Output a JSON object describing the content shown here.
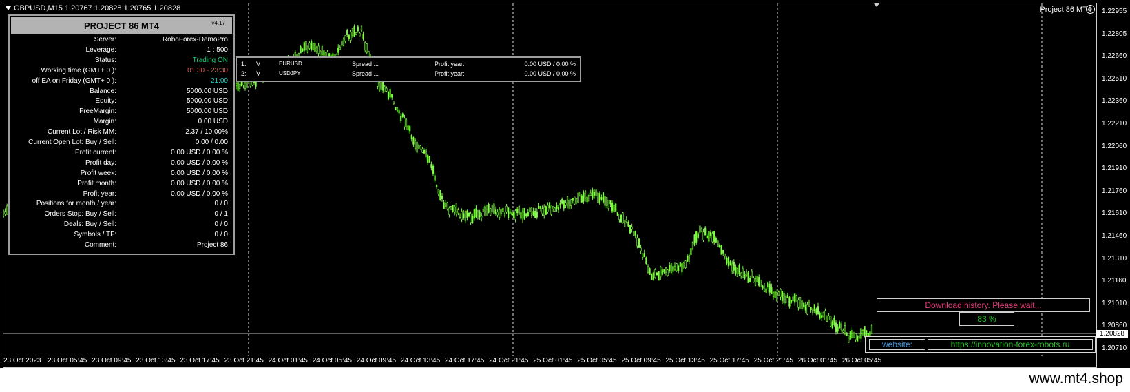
{
  "chart": {
    "symbol_header": "GBPUSD,M15  1.20767 1.20828 1.20765 1.20828",
    "ea_label": "Project 86 MT4",
    "current_price": "1.20828",
    "bull_color": "#7cff3c",
    "bear_color": "#7cff3c",
    "price_ticks": [
      "1.22955",
      "1.22805",
      "1.22660",
      "1.22510",
      "1.22360",
      "1.22210",
      "1.22060",
      "1.21910",
      "1.21760",
      "1.21610",
      "1.21460",
      "1.21310",
      "1.21160",
      "1.21010",
      "1.20860",
      "1.20710"
    ],
    "time_ticks": [
      "23 Oct 2023",
      "23 Oct 05:45",
      "23 Oct 09:45",
      "23 Oct 13:45",
      "23 Oct 17:45",
      "23 Oct 21:45",
      "24 Oct 01:45",
      "24 Oct 05:45",
      "24 Oct 09:45",
      "24 Oct 13:45",
      "24 Oct 17:45",
      "24 Oct 21:45",
      "25 Oct 01:45",
      "25 Oct 05:45",
      "25 Oct 09:45",
      "25 Oct 13:45",
      "25 Oct 17:45",
      "25 Oct 21:45",
      "26 Oct 01:45",
      "26 Oct 05:45"
    ]
  },
  "panel": {
    "title": "PROJECT 86 MT4",
    "version": "v4.17",
    "rows": [
      {
        "label": "Server:",
        "value": "RoboForex-DemoPro",
        "color": "#ffffff"
      },
      {
        "label": "Leverage:",
        "value": "1 : 500",
        "color": "#ffffff"
      },
      {
        "label": "Status:",
        "value": "Trading ON",
        "color": "#1ed07c"
      },
      {
        "label": "Working time (GMT+ 0 ):",
        "value": "01:30 - 23:30",
        "color": "#e05a5a"
      },
      {
        "label": "off EA on Friday (GMT+ 0 ):",
        "value": "21:00",
        "color": "#1ed0c0"
      },
      {
        "label": "Balance:",
        "value": "5000.00 USD",
        "color": "#ffffff"
      },
      {
        "label": "Equity:",
        "value": "5000.00 USD",
        "color": "#ffffff"
      },
      {
        "label": "FreeMargin:",
        "value": "5000.00 USD",
        "color": "#ffffff"
      },
      {
        "label": "Margin:",
        "value": "0.00 USD",
        "color": "#ffffff"
      },
      {
        "label": "Current Lot / Risk MM:",
        "value": "2.37 / 10.00%",
        "color": "#ffffff"
      },
      {
        "label": "Current Open Lot: Buy / Sell:",
        "value": "0.00  /  0.00",
        "color": "#ffffff"
      },
      {
        "label": "Profit current:",
        "value": "0.00 USD / 0.00 %",
        "color": "#ffffff"
      },
      {
        "label": "Profit day:",
        "value": "0.00 USD / 0.00 %",
        "color": "#ffffff"
      },
      {
        "label": "Profit week:",
        "value": "0.00 USD / 0.00 %",
        "color": "#ffffff"
      },
      {
        "label": "Profit month:",
        "value": "0.00 USD / 0.00 %",
        "color": "#ffffff"
      },
      {
        "label": "Profit year:",
        "value": "0.00 USD / 0.00 %",
        "color": "#ffffff"
      },
      {
        "label": "Positions for month / year:",
        "value": "0  /  0",
        "color": "#ffffff"
      },
      {
        "label": "Orders Stop: Buy / Sell:",
        "value": "0  /  1",
        "color": "#ffffff"
      },
      {
        "label": "Deals: Buy / Sell:",
        "value": "0  /  0",
        "color": "#ffffff"
      },
      {
        "label": "Symbols / TF:",
        "value": "0  /  0",
        "color": "#ffffff"
      },
      {
        "label": "Comment:",
        "value": "Project 86",
        "color": "#ffffff"
      }
    ]
  },
  "symbols": [
    {
      "num": "1:",
      "flag": "V",
      "symbol": "EURUSD",
      "spread": "Spread ...",
      "profit_label": "Profit year:",
      "profit": "0.00 USD / 0.00 %"
    },
    {
      "num": "2:",
      "flag": "V",
      "symbol": "USDJPY",
      "spread": "Spread ...",
      "profit_label": "Profit year:",
      "profit": "0.00 USD / 0.00 %"
    }
  ],
  "download": {
    "message": "Download history.    Please wait...",
    "percent": "83 %"
  },
  "website": {
    "label": "website:",
    "url": "https://innovation-forex-robots.ru"
  },
  "footer": {
    "brand": "www.mt4.shop"
  }
}
